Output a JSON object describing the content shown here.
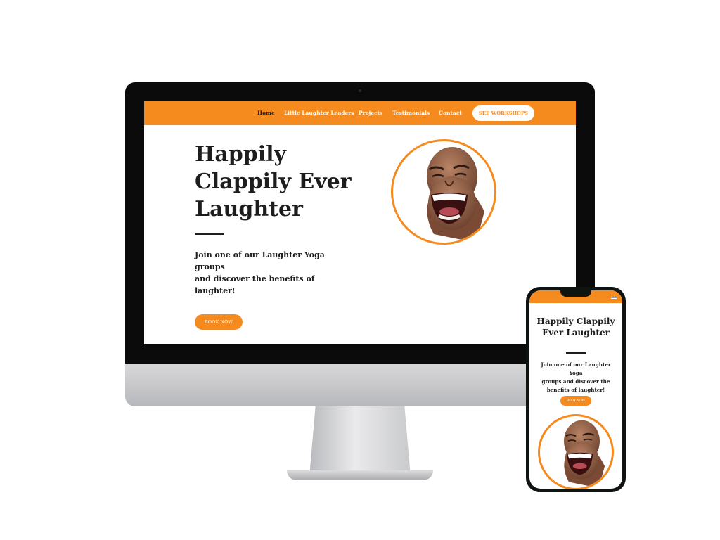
{
  "desktop": {
    "nav": {
      "items": [
        "Home",
        "Little Laughter Leaders",
        "Projects",
        "Testimonials",
        "Contact"
      ],
      "cta": "SEE WORKSHOPS"
    },
    "hero": {
      "title_lines": [
        "Happily",
        "Clappily Ever",
        "Laughter"
      ],
      "subtitle_lines": [
        "Join one of our Laughter Yoga groups",
        "and discover the benefits of laughter!"
      ],
      "button": "BOOK NOW",
      "image": "laughing-man-portrait"
    }
  },
  "mobile": {
    "nav": {
      "menu_icon": "hamburger-icon"
    },
    "hero": {
      "title_lines": [
        "Happily Clappily",
        "Ever Laughter"
      ],
      "subtitle_lines": [
        "Join one of our Laughter Yoga",
        "groups and discover the",
        "benefits of laughter!"
      ],
      "button": "BOOK NOW",
      "image": "laughing-man-portrait"
    }
  },
  "colors": {
    "brand_orange": "#f58a1f",
    "text_dark": "#1d1d1d",
    "device_black": "#0b0b0b",
    "background": "#ffffff"
  }
}
